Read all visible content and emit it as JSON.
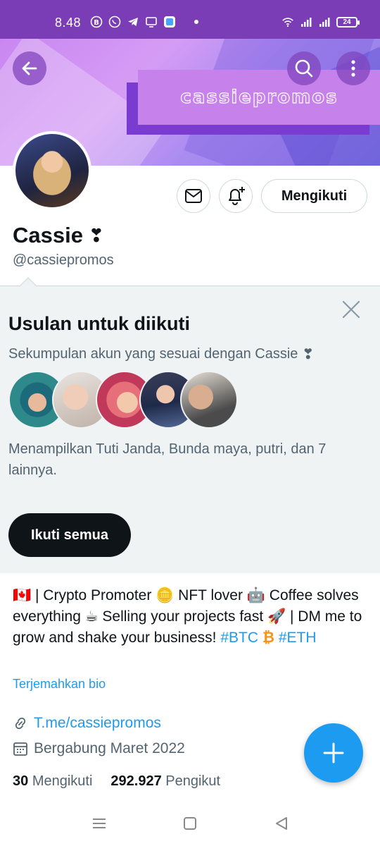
{
  "status_bar": {
    "time": "8.48",
    "battery": "24",
    "left_icons": [
      "b-icon",
      "whatsapp-icon",
      "telegram-icon",
      "tv-icon",
      "app-icon"
    ],
    "right_icons": [
      "wifi-icon",
      "signal-icon",
      "signal-icon"
    ]
  },
  "banner": {
    "brand_text": "cassiepromos",
    "colors": {
      "primary": "#c987f0",
      "plate": "#c781ea",
      "plate_shadow": "#7a3bd1"
    }
  },
  "profile": {
    "name": "Cassie",
    "name_emoji": "❣",
    "handle": "@cassiepromos",
    "following_button": "Mengikuti"
  },
  "suggestions": {
    "title": "Usulan untuk diikuti",
    "subtitle": "Sekumpulan akun yang sesuai dengan Cassie",
    "subtitle_emoji": "❣",
    "shows_text": "Menampilkan Tuti Janda, Bunda maya, putri, dan 7 lainnya.",
    "follow_all": "Ikuti semua"
  },
  "bio": {
    "flag": "🇨🇦",
    "p1": " | Crypto Promoter ",
    "coin": "🪙",
    "p2": " NFT lover ",
    "robot": "🤖",
    "p3": " Coffee solves everything ",
    "coffee": "☕",
    "p4": " Selling your projects fast ",
    "rocket": "🚀",
    "p5": " | DM me to grow and shake your business! ",
    "tag_btc": "#BTC",
    "btc_symbol": "₿",
    "tag_eth": "#ETH",
    "translate": "Terjemahkan bio"
  },
  "meta": {
    "link": "T.me/cassiepromos",
    "joined": "Bergabung Maret 2022"
  },
  "counts": {
    "following_num": "30",
    "following_label": "Mengikuti",
    "followers_num": "292.927",
    "followers_label": "Pengikut"
  },
  "colors": {
    "accent": "#1d9bf0",
    "status_bar": "#7b3db6",
    "card_bg": "#eff3f4"
  }
}
